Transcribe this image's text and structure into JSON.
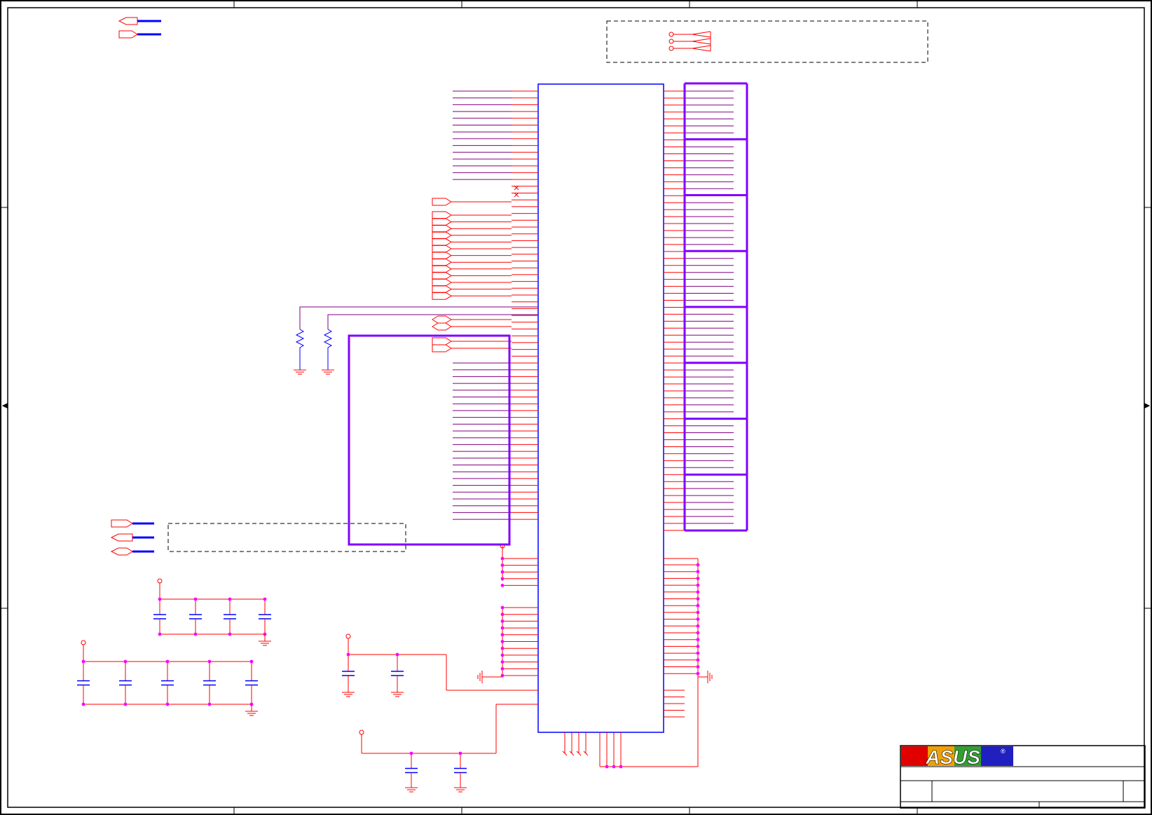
{
  "title_block": {
    "logo_text": "ASUS",
    "logo_registered": "®"
  },
  "colors": {
    "wire": "#ff0000",
    "net_line": "#800080",
    "component_outline": "#0000ff",
    "bus_group": "#8000ff",
    "junction": "#ff00ff",
    "frame": "#000000"
  }
}
